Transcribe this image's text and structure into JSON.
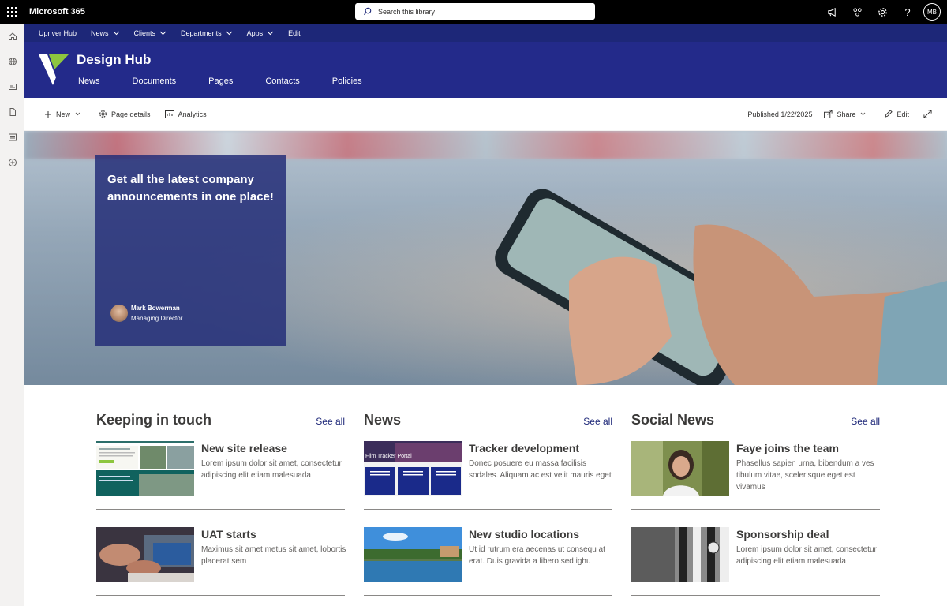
{
  "suite": {
    "brand": "Microsoft 365",
    "search_placeholder": "Search this library",
    "avatar_initials": "MB"
  },
  "hubnav": {
    "items": [
      {
        "label": "Upriver Hub",
        "has_menu": false
      },
      {
        "label": "News",
        "has_menu": true
      },
      {
        "label": "Clients",
        "has_menu": true
      },
      {
        "label": "Departments",
        "has_menu": true
      },
      {
        "label": "Apps",
        "has_menu": true
      },
      {
        "label": "Edit",
        "has_menu": false
      }
    ]
  },
  "site": {
    "title": "Design Hub",
    "nav": [
      "News",
      "Documents",
      "Pages",
      "Contacts",
      "Policies"
    ],
    "brand_colors": {
      "header": "#232a8a",
      "hubnav": "#1d2778",
      "logo_accent": "#8dc63f"
    }
  },
  "commandbar": {
    "new": "New",
    "page_details": "Page details",
    "analytics": "Analytics",
    "published": "Published 1/22/2025",
    "share": "Share",
    "edit": "Edit"
  },
  "hero": {
    "title": "Get all the latest company announcements in one place!",
    "author_name": "Mark Bowerman",
    "author_role": "Managing Director"
  },
  "columns": [
    {
      "title": "Keeping in touch",
      "see_all": "See all",
      "cards": [
        {
          "title": "New site release",
          "desc": "Lorem ipsum dolor sit amet, consectetur adipiscing elit etiam malesuada",
          "thumb": "site-screenshot"
        },
        {
          "title": "UAT starts",
          "desc": "Maximus sit amet metus sit amet, lobortis placerat sem",
          "thumb": "hands-laptop"
        }
      ]
    },
    {
      "title": "News",
      "see_all": "See all",
      "cards": [
        {
          "title": "Tracker development",
          "desc": "Donec posuere eu massa facilisis sodales. Aliquam ac est velit mauris eget",
          "thumb": "film-tracker",
          "thumb_label": "Film Tracker Portal"
        },
        {
          "title": "New studio locations",
          "desc": "Ut id rutrum era aecenas ut consequ at erat. Duis gravida a libero sed ighu",
          "thumb": "river-town"
        }
      ]
    },
    {
      "title": "Social News",
      "see_all": "See all",
      "cards": [
        {
          "title": "Faye joins the team",
          "desc": "Phasellus sapien urna, bibendum a ves tibulum vitae, scelerisque eget est vivamus",
          "thumb": "woman-portrait"
        },
        {
          "title": "Sponsorship deal",
          "desc": "Lorem ipsum dolor sit amet, consectetur adipiscing elit etiam malesuada",
          "thumb": "football-shirt"
        }
      ]
    }
  ]
}
